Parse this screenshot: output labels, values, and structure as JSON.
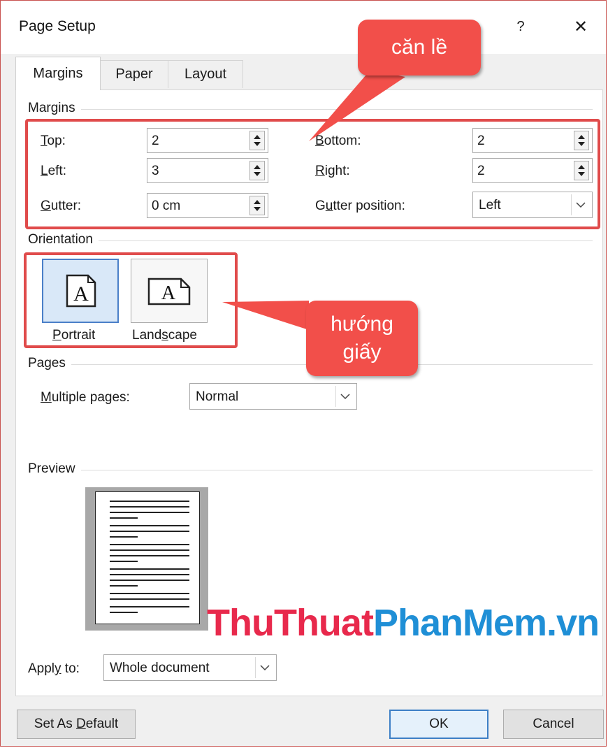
{
  "window": {
    "title": "Page Setup",
    "help_label": "?",
    "close_label": "✕"
  },
  "tabs": [
    {
      "label": "Margins",
      "active": true
    },
    {
      "label": "Paper",
      "active": false
    },
    {
      "label": "Layout",
      "active": false
    }
  ],
  "margins": {
    "group_title": "Margins",
    "top": {
      "label_u": "T",
      "label_rest": "op:",
      "value": "2"
    },
    "left": {
      "label_u": "L",
      "label_rest": "eft:",
      "value": "3"
    },
    "gutter": {
      "label_u": "G",
      "label_rest": "utter:",
      "value": "0 cm"
    },
    "bottom": {
      "label_u": "B",
      "label_rest": "ottom:",
      "value": "2"
    },
    "right": {
      "label_u": "R",
      "label_rest": "ight:",
      "value": "2"
    },
    "gutter_position": {
      "label_pre": "G",
      "label_u": "u",
      "label_rest": "tter position:",
      "value": "Left"
    }
  },
  "orientation": {
    "group_title": "Orientation",
    "portrait": {
      "label_u": "P",
      "label_rest": "ortrait",
      "glyph": "A",
      "selected": true
    },
    "landscape": {
      "label_pre": "Land",
      "label_u": "s",
      "label_rest": "cape",
      "glyph": "A",
      "selected": false
    }
  },
  "pages": {
    "group_title": "Pages",
    "multiple_pages": {
      "label_u": "M",
      "label_rest": "ultiple pages:",
      "value": "Normal"
    }
  },
  "preview": {
    "group_title": "Preview"
  },
  "apply_to": {
    "label_pre": "Appl",
    "label_u": "y",
    "label_rest": " to:",
    "value": "Whole document"
  },
  "buttons": {
    "set_default": {
      "label_pre": "Set As ",
      "label_u": "D",
      "label_rest": "efault"
    },
    "ok": "OK",
    "cancel": "Cancel"
  },
  "annotations": {
    "margins_callout": "căn lề",
    "orientation_callout_line1": "hướng",
    "orientation_callout_line2": "giấy"
  },
  "watermark": {
    "part1": "ThuThuat",
    "part2": "PhanMem",
    "part3": ".vn"
  },
  "colors": {
    "accent_red": "#e04b4b",
    "callout_red": "#f24f4a",
    "watermark_red": "#e8294c",
    "watermark_blue": "#1f8fd6",
    "selected_blue": "#4a7fc8"
  }
}
